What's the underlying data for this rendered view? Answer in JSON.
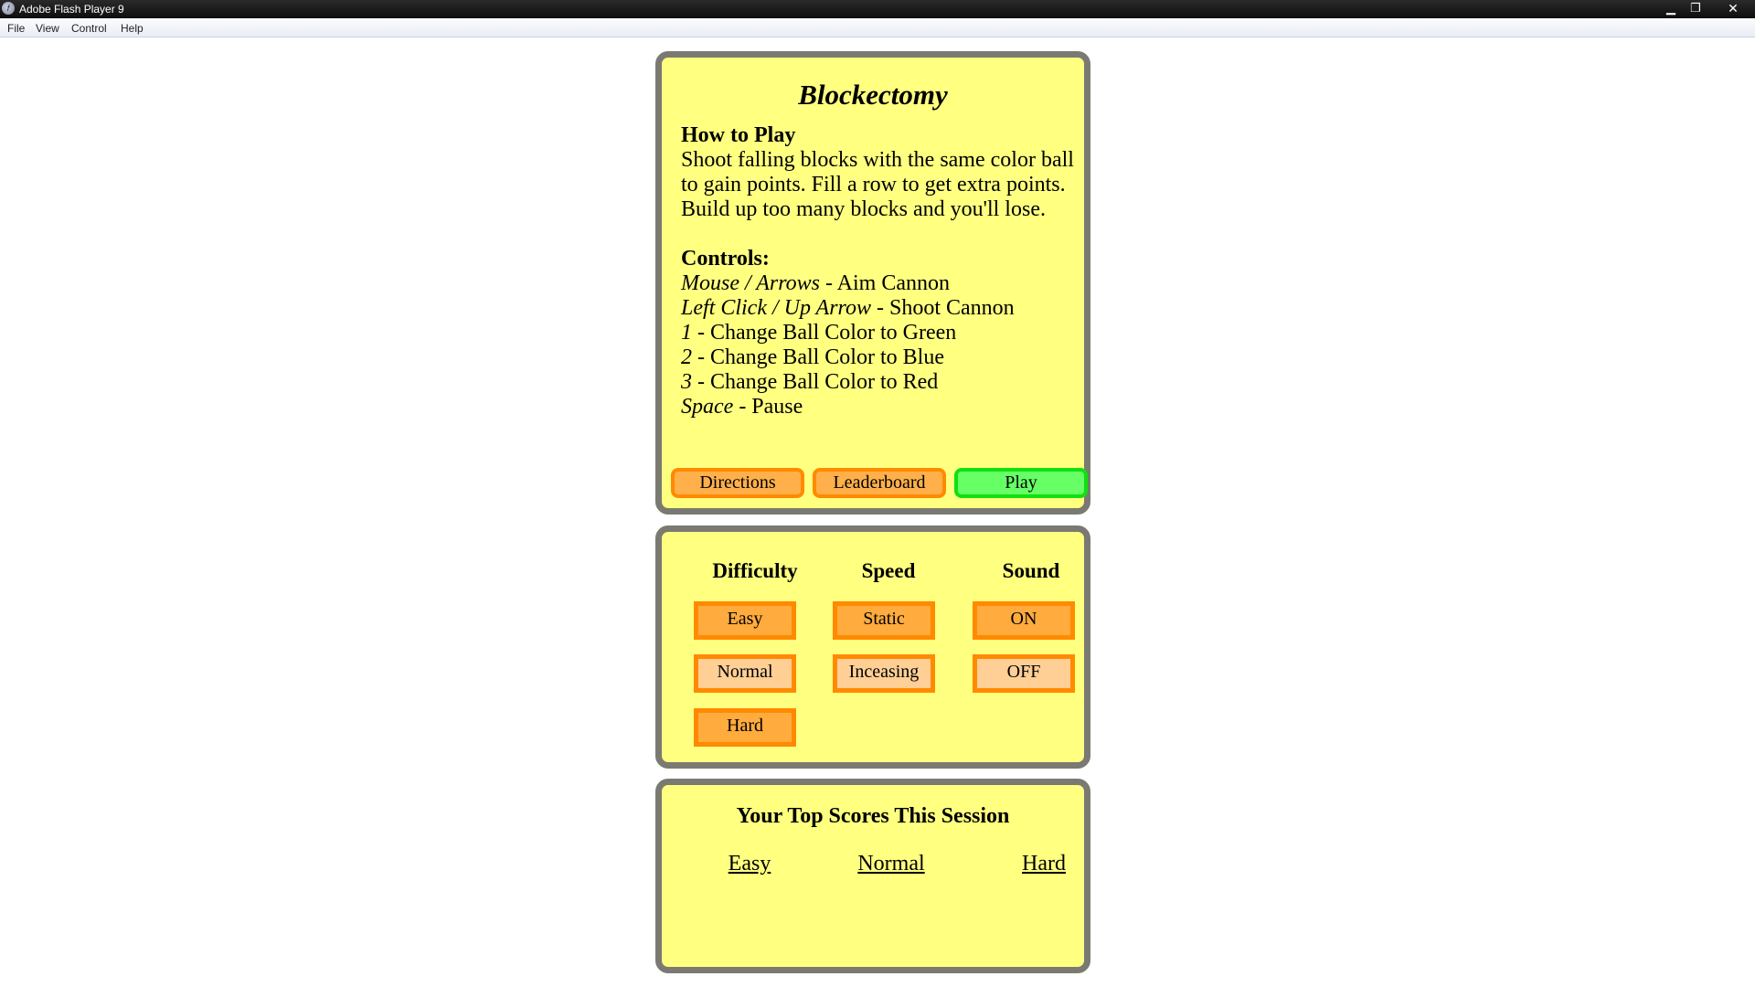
{
  "window": {
    "title": "Adobe Flash Player 9",
    "app_icon": "f",
    "minimize_glyph": "▁",
    "maximize_glyph": "❐",
    "close_glyph": "✕"
  },
  "menu": [
    "File",
    "View",
    "Control",
    "Help"
  ],
  "game": {
    "title": "Blockectomy",
    "how_to_play": {
      "heading": "How to Play",
      "lines": [
        "Shoot falling blocks with the same color ball",
        "to gain points. Fill a row to get extra points.",
        "Build up too many blocks and you'll lose."
      ]
    },
    "controls": {
      "heading": "Controls:",
      "items": [
        {
          "key": "Mouse / Arrows",
          "action": " - Aim Cannon"
        },
        {
          "key": "Left Click / Up Arrow",
          "action": " - Shoot Cannon"
        },
        {
          "key": "1",
          "action": " - Change Ball Color to Green"
        },
        {
          "key": "2",
          "action": " - Change Ball Color to Blue"
        },
        {
          "key": "3",
          "action": " - Change Ball Color to Red"
        },
        {
          "key": "Space",
          "action": " - Pause"
        }
      ]
    },
    "buttons": {
      "directions": "Directions",
      "leaderboard": "Leaderboard",
      "play": "Play"
    }
  },
  "settings": {
    "difficulty": {
      "heading": "Difficulty",
      "options": [
        "Easy",
        "Normal",
        "Hard"
      ],
      "selected": "Normal"
    },
    "speed": {
      "heading": "Speed",
      "options": [
        "Static",
        "Inceasing"
      ],
      "selected": "Inceasing"
    },
    "sound": {
      "heading": "Sound",
      "options": [
        "ON",
        "OFF"
      ],
      "selected": "OFF"
    }
  },
  "scores": {
    "title": "Your Top Scores This Session",
    "columns": [
      "Easy",
      "Normal",
      "Hard"
    ]
  },
  "colors": {
    "panel_bg": "#ffff80",
    "panel_border": "#7a7a72",
    "button_orange": "#ffb04a",
    "button_green": "#66ff66"
  }
}
